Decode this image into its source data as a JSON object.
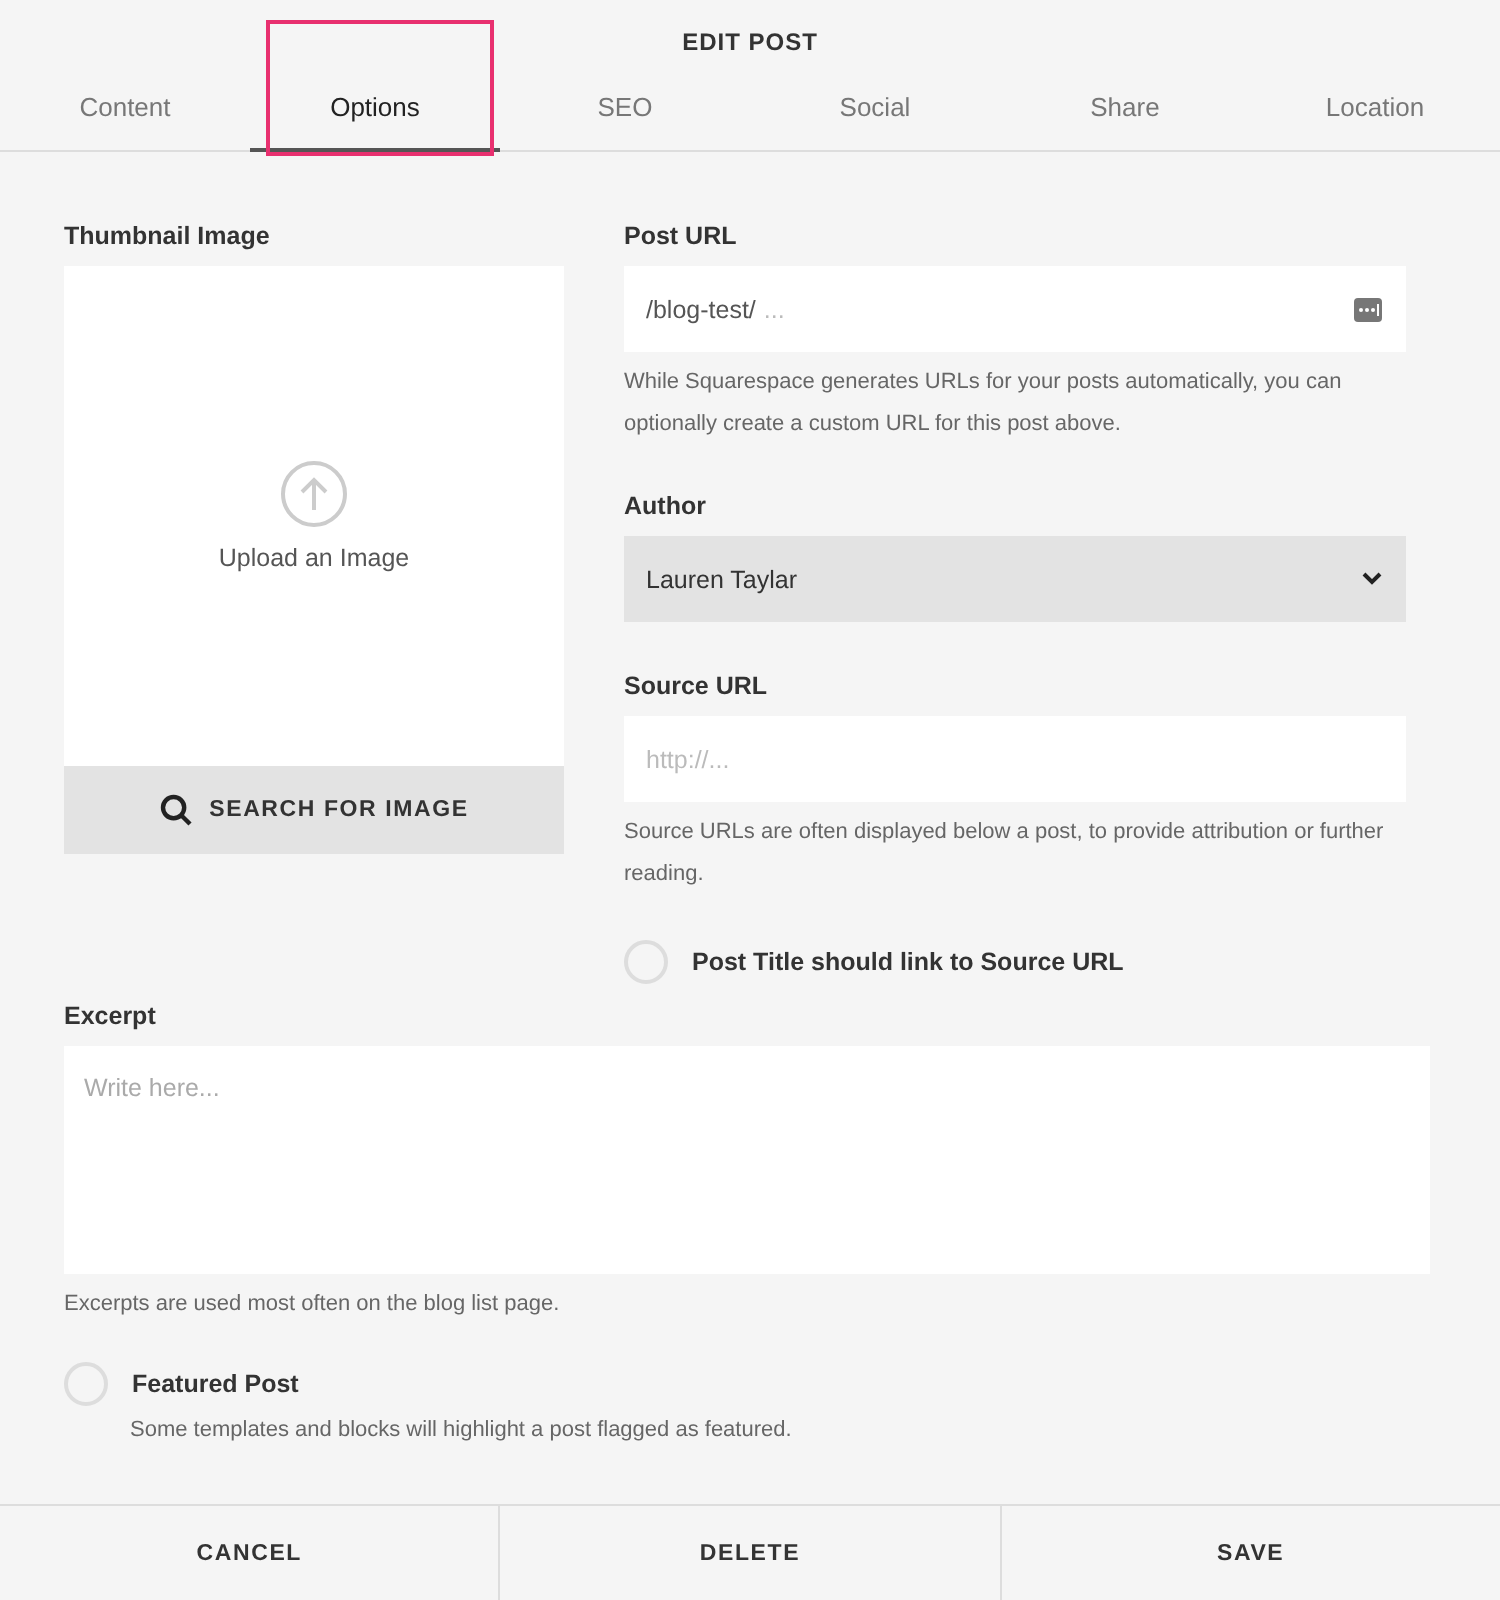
{
  "title": "EDIT POST",
  "tabs": [
    {
      "label": "Content",
      "selected": false,
      "highlighted": false
    },
    {
      "label": "Options",
      "selected": true,
      "highlighted": true
    },
    {
      "label": "SEO",
      "selected": false,
      "highlighted": false
    },
    {
      "label": "Social",
      "selected": false,
      "highlighted": false
    },
    {
      "label": "Share",
      "selected": false,
      "highlighted": false
    },
    {
      "label": "Location",
      "selected": false,
      "highlighted": false
    }
  ],
  "thumbnail": {
    "label": "Thumbnail Image",
    "upload_text": "Upload an Image",
    "search_button": "SEARCH FOR IMAGE"
  },
  "post_url": {
    "label": "Post URL",
    "value": "/blog-test/",
    "suffix": "...",
    "help": "While Squarespace generates URLs for your posts automatically, you can optionally create a custom URL for this post above."
  },
  "author": {
    "label": "Author",
    "value": "Lauren Taylar"
  },
  "source_url": {
    "label": "Source URL",
    "placeholder": "http://...",
    "help": "Source URLs are often displayed below a post, to provide attribution or further reading."
  },
  "link_to_source": {
    "label": "Post Title should link to Source URL",
    "checked": false
  },
  "excerpt": {
    "label": "Excerpt",
    "placeholder": "Write here...",
    "help": "Excerpts are used most often on the blog list page."
  },
  "featured": {
    "label": "Featured Post",
    "description": "Some templates and blocks will highlight a post flagged as featured.",
    "checked": false
  },
  "footer_buttons": [
    "CANCEL",
    "DELETE",
    "SAVE"
  ]
}
